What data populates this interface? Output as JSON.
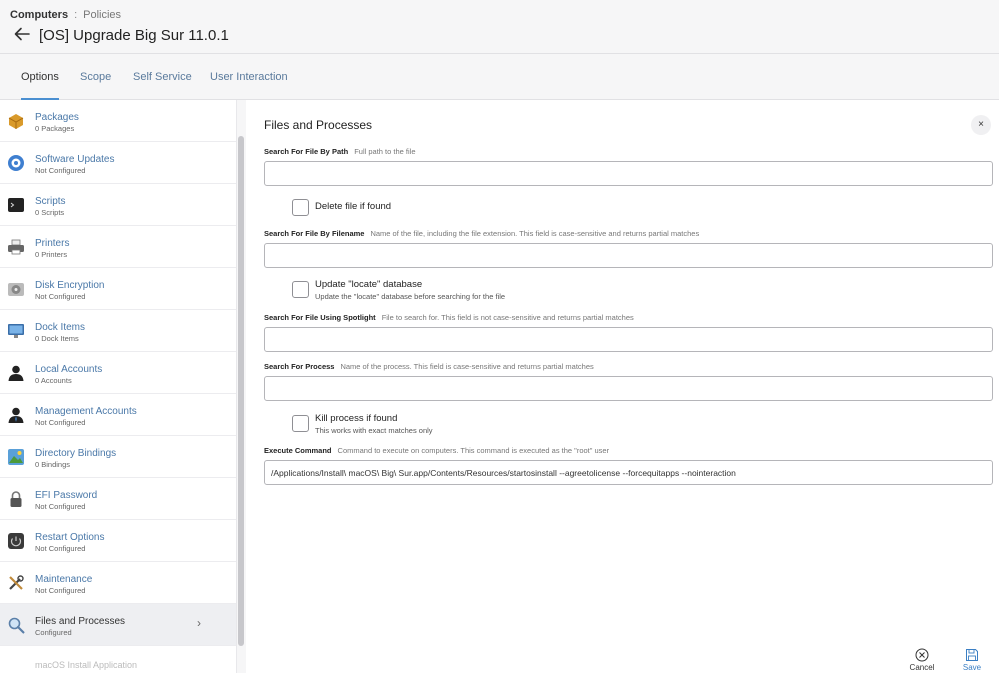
{
  "breadcrumb": {
    "section": "Computers",
    "separator": ":",
    "page": "Policies"
  },
  "page_title": "[OS] Upgrade Big Sur 11.0.1",
  "tabs": [
    {
      "label": "Options",
      "active": true
    },
    {
      "label": "Scope",
      "active": false
    },
    {
      "label": "Self Service",
      "active": false
    },
    {
      "label": "User Interaction",
      "active": false
    }
  ],
  "sidebar": {
    "items": [
      {
        "label": "Packages",
        "sub": "0 Packages",
        "icon": "package-icon"
      },
      {
        "label": "Software Updates",
        "sub": "Not Configured",
        "icon": "software-update-icon"
      },
      {
        "label": "Scripts",
        "sub": "0 Scripts",
        "icon": "terminal-icon"
      },
      {
        "label": "Printers",
        "sub": "0 Printers",
        "icon": "printer-icon"
      },
      {
        "label": "Disk Encryption",
        "sub": "Not Configured",
        "icon": "disk-encryption-icon"
      },
      {
        "label": "Dock Items",
        "sub": "0 Dock Items",
        "icon": "monitor-icon"
      },
      {
        "label": "Local Accounts",
        "sub": "0 Accounts",
        "icon": "user-icon"
      },
      {
        "label": "Management Accounts",
        "sub": "Not Configured",
        "icon": "admin-user-icon"
      },
      {
        "label": "Directory Bindings",
        "sub": "0 Bindings",
        "icon": "directory-icon"
      },
      {
        "label": "EFI Password",
        "sub": "Not Configured",
        "icon": "lock-icon"
      },
      {
        "label": "Restart Options",
        "sub": "Not Configured",
        "icon": "restart-icon"
      },
      {
        "label": "Maintenance",
        "sub": "Not Configured",
        "icon": "tools-icon"
      },
      {
        "label": "Files and Processes",
        "sub": "Configured",
        "icon": "magnifier-icon",
        "active": true,
        "chevron": "›"
      }
    ],
    "cut_off_text": "macOS Install Application"
  },
  "main": {
    "title": "Files and Processes",
    "close_symbol": "×",
    "search_path": {
      "label": "Search For File By Path",
      "hint": "Full path to the file",
      "value": ""
    },
    "delete_file": {
      "label": "Delete file if found",
      "checked": false
    },
    "search_filename": {
      "label": "Search For File By Filename",
      "hint": "Name of the file, including the file extension. This field is case-sensitive and returns partial matches",
      "value": ""
    },
    "update_locate": {
      "label": "Update \"locate\" database",
      "sub": "Update the \"locate\" database before searching for the file",
      "checked": false
    },
    "search_spotlight": {
      "label": "Search For File Using Spotlight",
      "hint": "File to search for. This field is not case-sensitive and returns partial matches",
      "value": ""
    },
    "search_process": {
      "label": "Search For Process",
      "hint": "Name of the process. This field is case-sensitive and returns partial matches",
      "value": ""
    },
    "kill_process": {
      "label": "Kill process if found",
      "sub": "This works with exact matches only",
      "checked": false
    },
    "execute_command": {
      "label": "Execute Command",
      "hint": "Command to execute on computers. This command is executed as the \"root\" user",
      "value": "/Applications/Install\\ macOS\\ Big\\ Sur.app/Contents/Resources/startosinstall --agreetolicense --forcequitapps --nointeraction"
    }
  },
  "footer": {
    "cancel_label": "Cancel",
    "save_label": "Save"
  },
  "colors": {
    "accent": "#4a8fd1",
    "link": "#4a78a8",
    "save": "#3b7fc4"
  }
}
